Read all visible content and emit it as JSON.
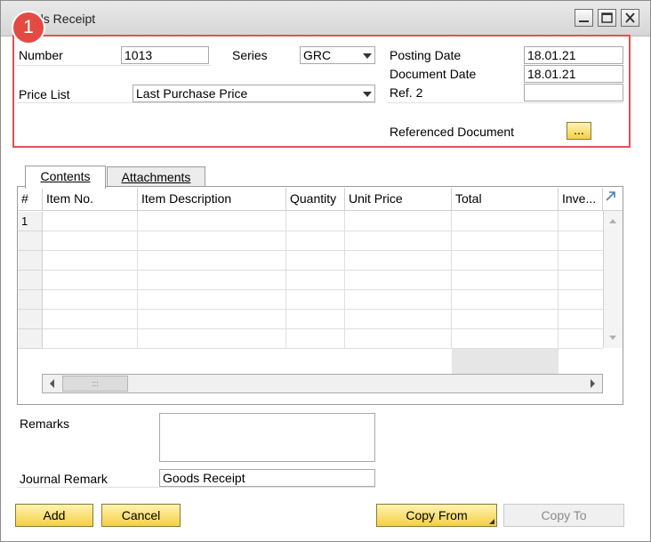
{
  "window": {
    "title": "Goods Receipt",
    "title_visible": "ds Receipt"
  },
  "badge": "1",
  "header": {
    "number_label": "Number",
    "number_value": "1013",
    "series_label": "Series",
    "series_value": "GRC",
    "price_list_label": "Price List",
    "price_list_value": "Last Purchase Price",
    "posting_date_label": "Posting Date",
    "posting_date_value": "18.01.21",
    "document_date_label": "Document Date",
    "document_date_value": "18.01.21",
    "ref2_label": "Ref. 2",
    "ref2_value": "",
    "referenced_document_label": "Referenced Document",
    "referenced_document_button": "..."
  },
  "tabs": [
    {
      "label": "Contents",
      "active": true
    },
    {
      "label": "Attachments",
      "active": false
    }
  ],
  "grid": {
    "columns": [
      "#",
      "Item No.",
      "Item Description",
      "Quantity",
      "Unit Price",
      "Total",
      "Inve..."
    ],
    "rows": [
      [
        "1",
        "",
        "",
        "",
        "",
        "",
        ""
      ],
      [
        "",
        "",
        "",
        "",
        "",
        "",
        ""
      ],
      [
        "",
        "",
        "",
        "",
        "",
        "",
        ""
      ],
      [
        "",
        "",
        "",
        "",
        "",
        "",
        ""
      ],
      [
        "",
        "",
        "",
        "",
        "",
        "",
        ""
      ],
      [
        "",
        "",
        "",
        "",
        "",
        "",
        ""
      ],
      [
        "",
        "",
        "",
        "",
        "",
        "",
        ""
      ]
    ]
  },
  "footer": {
    "remarks_label": "Remarks",
    "remarks_value": "",
    "journal_remark_label": "Journal Remark",
    "journal_remark_value": "Goods Receipt"
  },
  "buttons": {
    "add": "Add",
    "cancel": "Cancel",
    "copy_from": "Copy From",
    "copy_to": "Copy To"
  },
  "colors": {
    "highlight": "#e05252",
    "badge": "#e34b42",
    "button_yellow": "#f5cf45"
  }
}
